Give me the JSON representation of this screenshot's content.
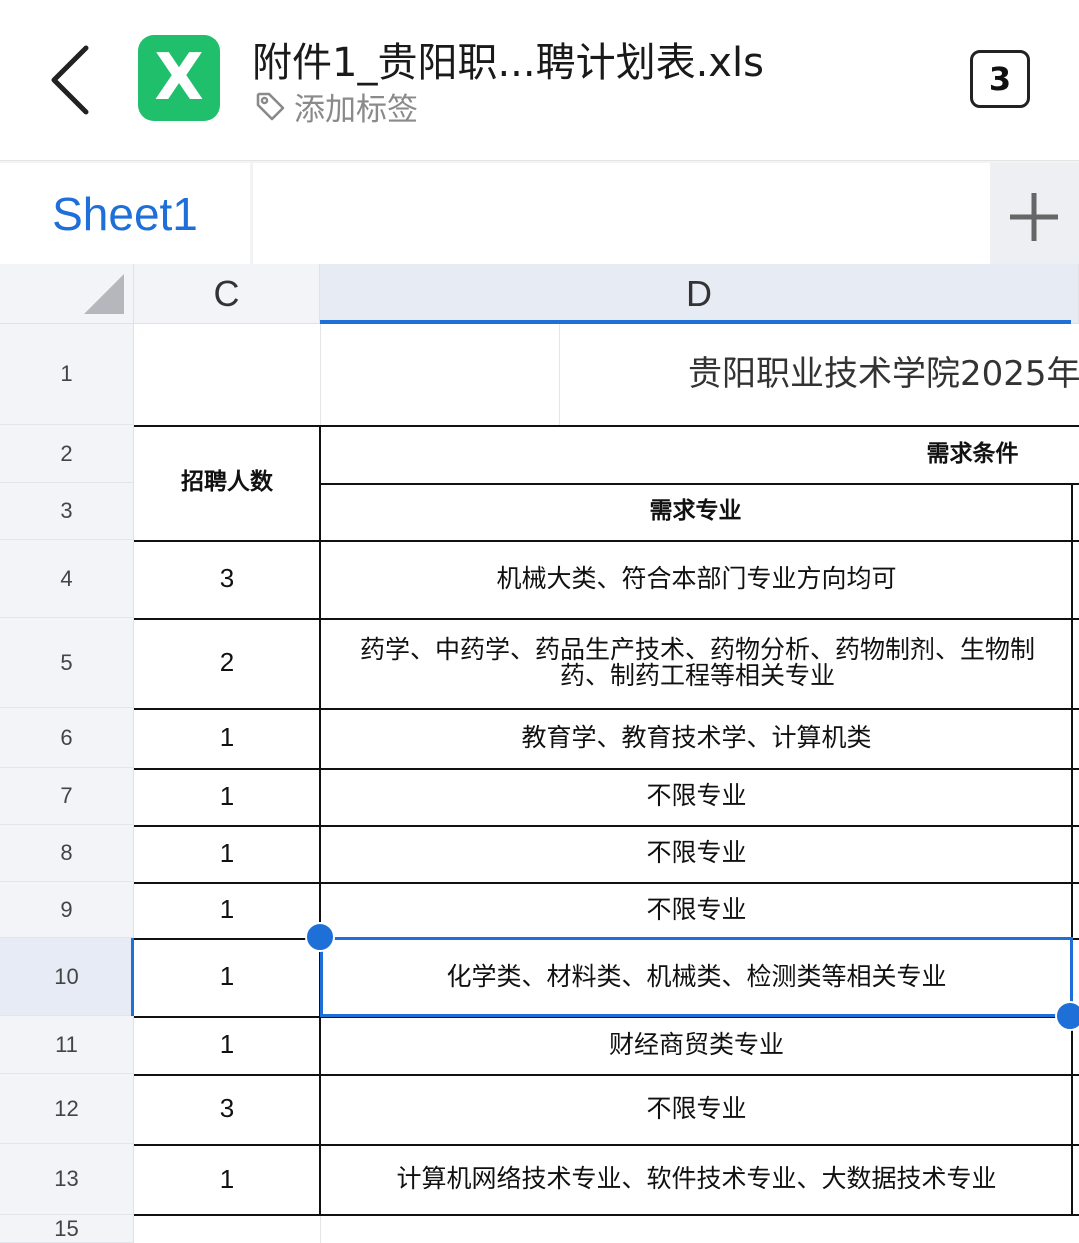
{
  "header": {
    "file_name": "附件1_贵阳职...聘计划表.xls",
    "file_icon_letter": "X",
    "tag_label": "添加标签",
    "window_count": "3"
  },
  "tabs": {
    "sheet_label": "Sheet1",
    "add_label": "+"
  },
  "grid": {
    "columns": [
      "C",
      "D"
    ],
    "row_numbers": [
      "1",
      "2",
      "3",
      "4",
      "5",
      "6",
      "7",
      "8",
      "9",
      "10",
      "11",
      "12",
      "13",
      "15"
    ],
    "title": "贵阳职业技术学院2025年",
    "header_count": "招聘人数",
    "header_requirements": "需求条件",
    "header_major": "需求专业",
    "rows": [
      {
        "count": "3",
        "major": "机械大类、符合本部门专业方向均可"
      },
      {
        "count": "2",
        "major": "药学、中药学、药品生产技术、药物分析、药物制剂、生物制药、制药工程等相关专业"
      },
      {
        "count": "1",
        "major": "教育学、教育技术学、计算机类"
      },
      {
        "count": "1",
        "major": "不限专业"
      },
      {
        "count": "1",
        "major": "不限专业"
      },
      {
        "count": "1",
        "major": "不限专业"
      },
      {
        "count": "1",
        "major": "化学类、材料类、机械类、检测类等相关专业"
      },
      {
        "count": "1",
        "major": "财经商贸类专业"
      },
      {
        "count": "3",
        "major": "不限专业"
      },
      {
        "count": "1",
        "major": "计算机网络技术专业、软件技术专业、大数据技术专业"
      }
    ],
    "selected_cell": "D10",
    "accent_color": "#1f6fd8"
  }
}
